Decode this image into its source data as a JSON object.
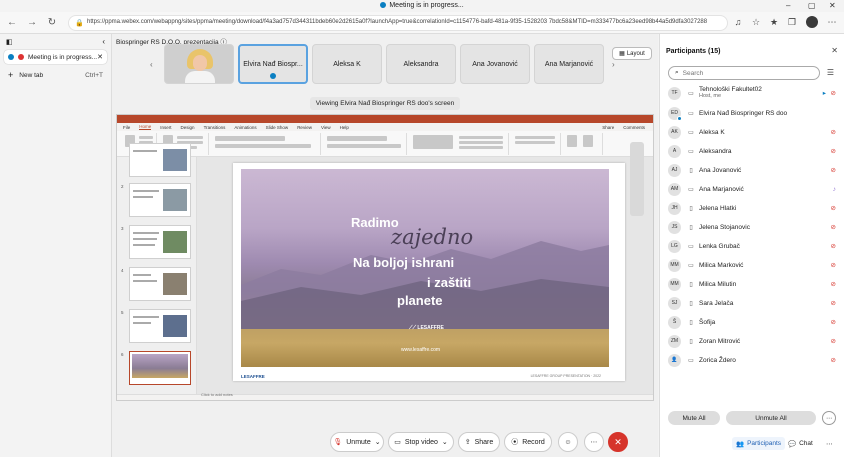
{
  "browser": {
    "window_title": "Meeting is in progress...",
    "url": "https://ppma.webex.com/webappng/sites/ppma/meeting/download/f4a3ad757d344311bdeb60e2d2615a0f?launchApp=true&correlationId=c1154776-bafd-481a-9f35-1528203 7bdc58&MTID=m333477bc6a23eed98b44a5d9dfa3027288"
  },
  "vertical_tabs": {
    "active_tab": "Meeting is in progress...",
    "new_tab": "New tab",
    "new_tab_shortcut": "Ctrl+T"
  },
  "meeting": {
    "title": "Biospringer RS D.O.O. prezentacija",
    "layout_label": "Layout",
    "viewing_banner": "Viewing Elvira Nađ Biospringer RS doo's screen",
    "filmstrip": [
      {
        "name": "Elvira Nađ Biospr..."
      },
      {
        "name": "Aleksa K"
      },
      {
        "name": "Aleksandra"
      },
      {
        "name": "Ana Jovanović"
      },
      {
        "name": "Ana Marjanović"
      }
    ]
  },
  "ppt": {
    "menu": [
      "File",
      "Home",
      "Insert",
      "Design",
      "Transitions",
      "Animations",
      "Slide Show",
      "Review",
      "View",
      "Help"
    ],
    "share_label": "Share",
    "comments_label": "Comments",
    "slide_numbers": [
      "2",
      "3",
      "4",
      "5",
      "6"
    ],
    "slide": {
      "line1": "Radimo",
      "script": "zajedno",
      "line2": "Na boljoj ishrani",
      "line3": "i zaštiti",
      "line4": "planete",
      "brand": "LESAFFRE",
      "site": "www.lesaffre.com",
      "footer_left": "LESAFFRE",
      "footer_right": "LESAFFRE GROUP PRESENTATION · 2022"
    },
    "notes_hint": "Click to add notes"
  },
  "controls": {
    "unmute": "Unmute",
    "stop_video": "Stop video",
    "share": "Share",
    "record": "Record"
  },
  "participants": {
    "header": "Participants (15)",
    "search_placeholder": "Search",
    "list": [
      {
        "initials": "TF",
        "name": "Tehnološki Fakultet02",
        "sub": "Host, me"
      },
      {
        "initials": "ED",
        "name": "Elvira Nađ Biospringer RS doo",
        "sub": ""
      },
      {
        "initials": "AK",
        "name": "Aleksa K",
        "sub": ""
      },
      {
        "initials": "A",
        "name": "Aleksandra",
        "sub": ""
      },
      {
        "initials": "AJ",
        "name": "Ana Jovanović",
        "sub": ""
      },
      {
        "initials": "AM",
        "name": "Ana Marjanović",
        "sub": ""
      },
      {
        "initials": "JH",
        "name": "Jelena Hlatki",
        "sub": ""
      },
      {
        "initials": "JS",
        "name": "Jelena Stojanovic",
        "sub": ""
      },
      {
        "initials": "LG",
        "name": "Lenka Grubač",
        "sub": ""
      },
      {
        "initials": "MM",
        "name": "Milica Marković",
        "sub": ""
      },
      {
        "initials": "MM",
        "name": "Milica Milutin",
        "sub": ""
      },
      {
        "initials": "SJ",
        "name": "Sara Jelača",
        "sub": ""
      },
      {
        "initials": "Š",
        "name": "Šofija",
        "sub": ""
      },
      {
        "initials": "ZM",
        "name": "Zoran Mitrović",
        "sub": ""
      },
      {
        "initials": "",
        "name": "Zorica Ždero",
        "sub": ""
      }
    ],
    "mute_all": "Mute All",
    "unmute_all": "Unmute All",
    "footer_participants": "Participants",
    "footer_chat": "Chat"
  }
}
